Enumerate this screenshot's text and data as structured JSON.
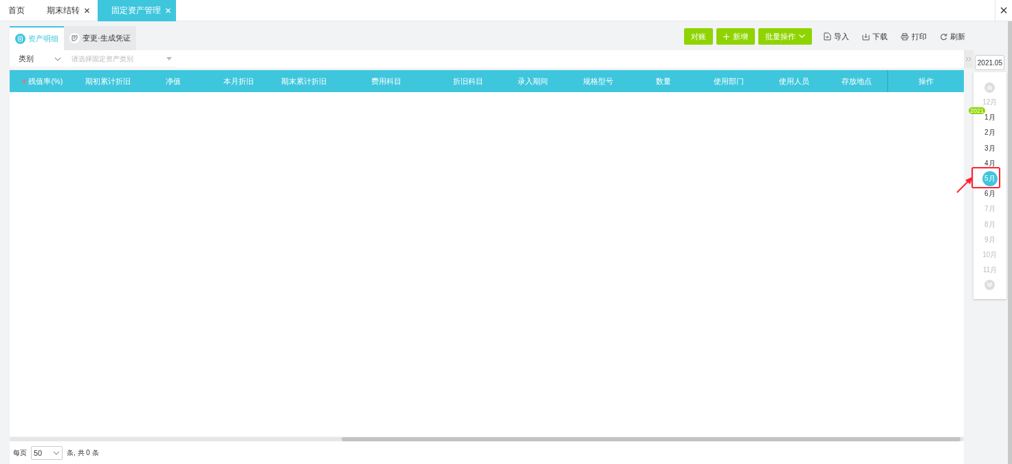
{
  "tabs": [
    {
      "label": "首页",
      "closable": false,
      "selected": false
    },
    {
      "label": "期末结转",
      "closable": true,
      "selected": false
    },
    {
      "label": "固定资产管理",
      "closable": true,
      "selected": true
    }
  ],
  "sub_tabs": [
    {
      "label": "资产明细",
      "selected": true
    },
    {
      "label": "变更·生成凭证",
      "selected": false
    }
  ],
  "toolbar": [
    {
      "label": "对账",
      "kind": "primary"
    },
    {
      "label": "新增",
      "kind": "primary"
    },
    {
      "label": "批量操作",
      "kind": "primary"
    },
    {
      "label": "导入",
      "kind": "link"
    },
    {
      "label": "下载",
      "kind": "link"
    },
    {
      "label": "打印",
      "kind": "link"
    },
    {
      "label": "刷新",
      "kind": "link"
    }
  ],
  "filter": {
    "field": "类别",
    "placeholder": "请选择固定资产类别"
  },
  "table": {
    "columns": [
      {
        "label": "残值率(%)",
        "required": true
      },
      {
        "label": "期初累计折旧",
        "required": false
      },
      {
        "label": "净值",
        "required": false
      },
      {
        "label": "本月折旧",
        "required": false
      },
      {
        "label": "期末累计折旧",
        "required": false
      },
      {
        "label": "费用科目",
        "required": false
      },
      {
        "label": "折旧科目",
        "required": false
      },
      {
        "label": "录入期间",
        "required": false
      },
      {
        "label": "规格型号",
        "required": false
      },
      {
        "label": "数量",
        "required": false
      },
      {
        "label": "使用部门",
        "required": false
      },
      {
        "label": "使用人员",
        "required": false
      },
      {
        "label": "存放地点",
        "required": false
      },
      {
        "label": "操作",
        "required": false
      }
    ]
  },
  "pagination": {
    "per_page_label": "每页",
    "page_size": "50",
    "total": "条, 共 0 条"
  },
  "period": {
    "value": "2021.05",
    "year_badge": "2021",
    "months": [
      {
        "label": "12月",
        "disabled": true,
        "selected": false
      },
      {
        "label": "1月",
        "disabled": false,
        "selected": false
      },
      {
        "label": "2月",
        "disabled": false,
        "selected": false
      },
      {
        "label": "3月",
        "disabled": false,
        "selected": false
      },
      {
        "label": "4月",
        "disabled": false,
        "selected": false
      },
      {
        "label": "5月",
        "disabled": false,
        "selected": true
      },
      {
        "label": "6月",
        "disabled": false,
        "selected": false
      },
      {
        "label": "7月",
        "disabled": true,
        "selected": false
      },
      {
        "label": "8月",
        "disabled": true,
        "selected": false
      },
      {
        "label": "9月",
        "disabled": true,
        "selected": false
      },
      {
        "label": "10月",
        "disabled": true,
        "selected": false
      },
      {
        "label": "11月",
        "disabled": true,
        "selected": false
      }
    ]
  }
}
